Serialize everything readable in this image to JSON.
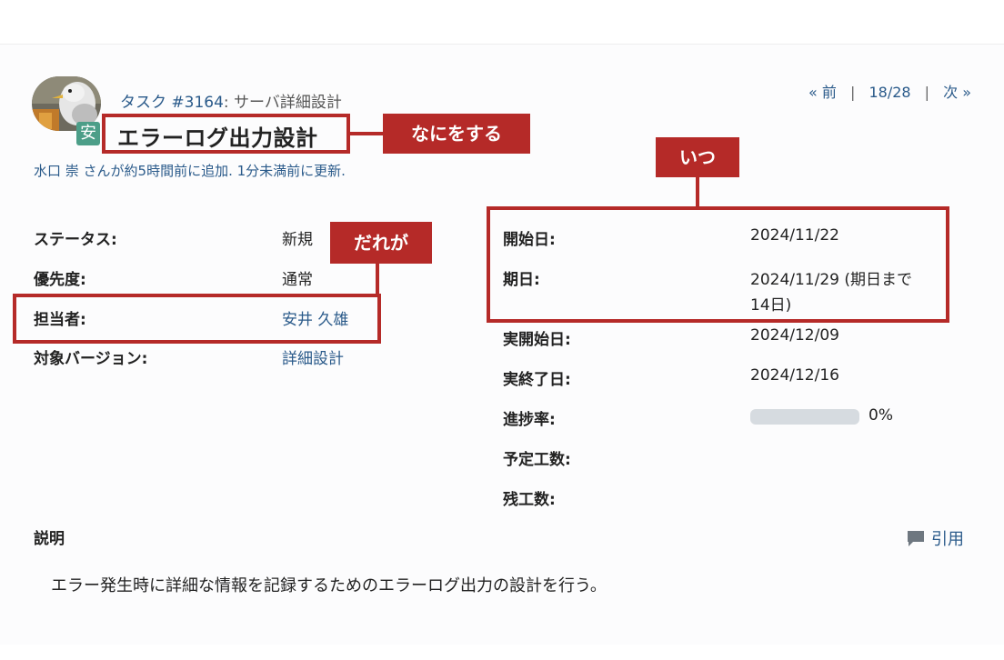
{
  "issue": {
    "tracker_link": "タスク #3164",
    "parent_subject": ": サーバ詳細設計",
    "subject": "エラーログ出力設計",
    "author_line": "水口 崇 さんが約5時間前に追加. 1分未満前に更新.",
    "avatar_badge": "安"
  },
  "nav": {
    "prev": "« 前",
    "separator": "|",
    "position": "18/28",
    "next": "次 »"
  },
  "attributes_left": [
    {
      "label": "ステータス:",
      "value": "新規"
    },
    {
      "label": "優先度:",
      "value": "通常"
    },
    {
      "label": "担当者:",
      "value": "安井 久雄"
    },
    {
      "label": "対象バージョン:",
      "value": "詳細設計"
    }
  ],
  "attributes_right": [
    {
      "label": "開始日:",
      "value": "2024/11/22"
    },
    {
      "label": "期日:",
      "value": "2024/11/29 (期日まで",
      "value2": "14日)"
    },
    {
      "label": "実開始日:",
      "value": "2024/12/09"
    },
    {
      "label": "実終了日:",
      "value": "2024/12/16"
    },
    {
      "label": "進捗率:",
      "value": "0%",
      "progress": 0
    },
    {
      "label": "予定工数:",
      "value": ""
    },
    {
      "label": "残工数:",
      "value": ""
    }
  ],
  "description": {
    "label": "説明",
    "quote_label": "引用",
    "text": "エラー発生時に詳細な情報を記録するためのエラーログ出力の設計を行う。"
  },
  "annotations": {
    "what": "なにをする",
    "who": "だれが",
    "when": "いつ"
  },
  "colors": {
    "accent": "#b52a28",
    "link": "#2a5a8a",
    "badge": "#4c9e88",
    "progress_track": "#d6dbe0"
  }
}
